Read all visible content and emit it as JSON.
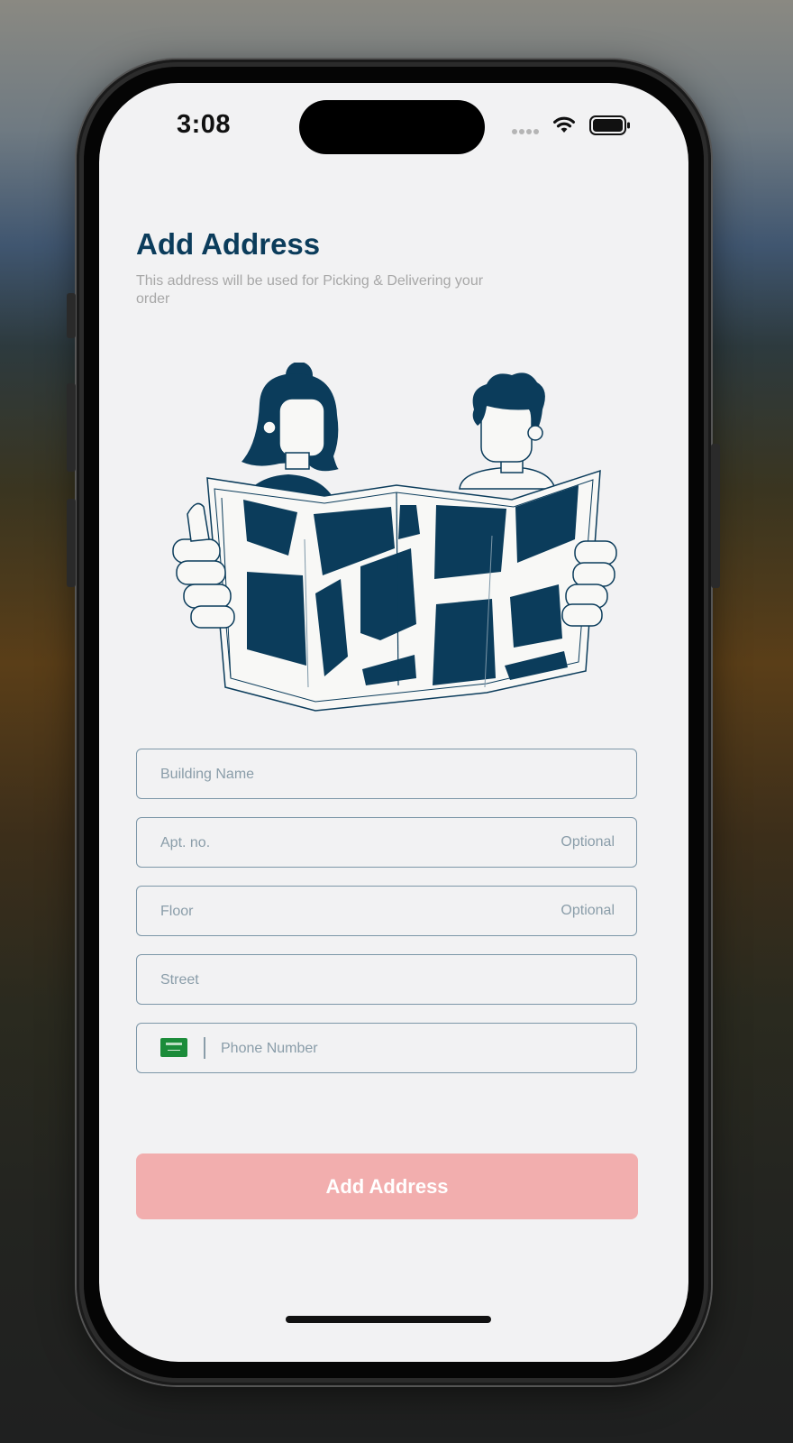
{
  "status_bar": {
    "time": "3:08"
  },
  "header": {
    "title": "Add Address",
    "subtitle": "This address will be used for Picking & Delivering your order"
  },
  "form": {
    "building_placeholder": "Building Name",
    "apt_placeholder": "Apt. no.",
    "apt_optional": "Optional",
    "floor_placeholder": "Floor",
    "floor_optional": "Optional",
    "street_placeholder": "Street",
    "phone_placeholder": "Phone Number"
  },
  "submit": {
    "label": "Add Address"
  },
  "colors": {
    "primary": "#0b3c5b",
    "button_disabled": "#f2aeae",
    "field_border": "#7d97a8",
    "background": "#f2f2f3"
  },
  "icons": [
    "wifi-icon",
    "battery-icon",
    "signal-dots-icon",
    "saudi-flag-icon"
  ]
}
